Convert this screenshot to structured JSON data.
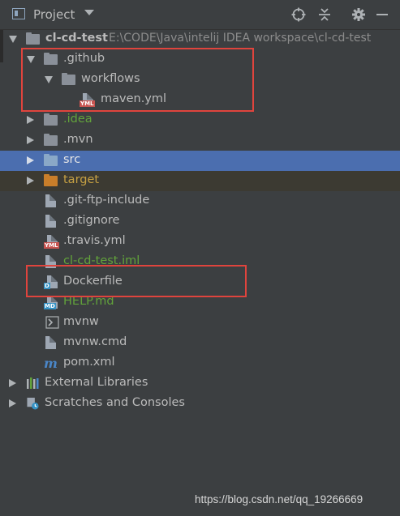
{
  "header": {
    "title": "Project",
    "buttons": [
      {
        "name": "locate-icon"
      },
      {
        "name": "collapse-icon"
      },
      {
        "name": "gear-icon"
      },
      {
        "name": "minimize-icon"
      }
    ]
  },
  "tree": {
    "root": {
      "label": "cl-cd-test",
      "path": "E:\\CODE\\Java\\intelij IDEA workspace\\cl-cd-test"
    },
    "github": {
      "label": ".github"
    },
    "workflows": {
      "label": "workflows"
    },
    "maven_yml": {
      "label": "maven.yml",
      "badge": "YML"
    },
    "idea": {
      "label": ".idea"
    },
    "mvn": {
      "label": ".mvn"
    },
    "src": {
      "label": "src"
    },
    "target": {
      "label": "target"
    },
    "git_ftp": {
      "label": ".git-ftp-include"
    },
    "gitignore": {
      "label": ".gitignore"
    },
    "travis": {
      "label": ".travis.yml",
      "badge": "YML"
    },
    "iml": {
      "label": "cl-cd-test.iml"
    },
    "dockerfile": {
      "label": "Dockerfile",
      "badge": "D"
    },
    "help": {
      "label": "HELP.md",
      "badge": "MD"
    },
    "mvnw": {
      "label": "mvnw"
    },
    "mvnw_cmd": {
      "label": "mvnw.cmd"
    },
    "pom": {
      "label": "pom.xml"
    },
    "external": {
      "label": "External Libraries"
    },
    "scratches": {
      "label": "Scratches and Consoles"
    }
  },
  "colors": {
    "background": "#3c3f41",
    "selection": "#4b6eaf",
    "excluded": "#3c3a32",
    "highlight_box": "#e0443d",
    "green_text": "#62a33b",
    "orange_text": "#c6a043"
  },
  "watermark": "https://blog.csdn.net/qq_19266669"
}
